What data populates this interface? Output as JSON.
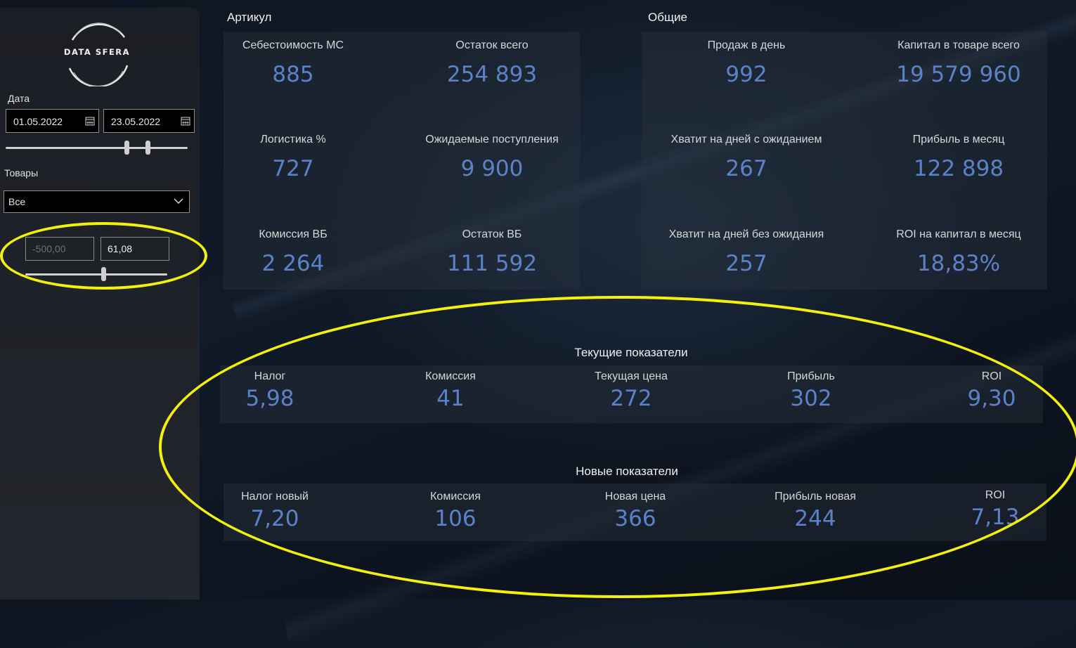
{
  "sidebar": {
    "logo_text": "DATA SFERA",
    "date_label": "Дата",
    "date_from": "01.05.2022",
    "date_to": "23.05.2022",
    "goods_label": "Товары",
    "goods_selected": "Все",
    "range_min_placeholder": "-500,00",
    "range_max_value": "61,08"
  },
  "article": {
    "title": "Артикул",
    "kpis": [
      {
        "label": "Себестоимость МС",
        "value": "885"
      },
      {
        "label": "Остаток всего",
        "value": "254 893"
      },
      {
        "label": "Логистика %",
        "value": "727"
      },
      {
        "label": "Ожидаемые поступления",
        "value": "9 900"
      },
      {
        "label": "Комиссия ВБ",
        "value": "2 264"
      },
      {
        "label": "Остаток ВБ",
        "value": "111 592"
      }
    ]
  },
  "general": {
    "title": "Общие",
    "kpis": [
      {
        "label": "Продаж в день",
        "value": "992"
      },
      {
        "label": "Капитал в товаре всего",
        "value": "19 579 960"
      },
      {
        "label": "Хватит на дней с ожиданием",
        "value": "267"
      },
      {
        "label": "Прибыль в месяц",
        "value": "122 898"
      },
      {
        "label": "Хватит на дней без ожидания",
        "value": "257"
      },
      {
        "label": "ROI на капитал в месяц",
        "value": "18,83%"
      }
    ]
  },
  "current": {
    "title": "Текущие показатели",
    "kpis": [
      {
        "label": "Налог",
        "value": "5,98"
      },
      {
        "label": "Комиссия",
        "value": "41"
      },
      {
        "label": "Текущая цена",
        "value": "272"
      },
      {
        "label": "Прибыль",
        "value": "302"
      },
      {
        "label": "ROI",
        "value": "9,30"
      }
    ]
  },
  "new": {
    "title": "Новые показатели",
    "kpis": [
      {
        "label": "Налог новый",
        "value": "7,20"
      },
      {
        "label": "Комиссия",
        "value": "106"
      },
      {
        "label": "Новая цена",
        "value": "366"
      },
      {
        "label": "Прибыль новая",
        "value": "244"
      },
      {
        "label": "ROI",
        "value": "7,13"
      }
    ]
  },
  "colors": {
    "accent_value": "#5b82c6",
    "highlight_ring": "#f4f00e"
  }
}
